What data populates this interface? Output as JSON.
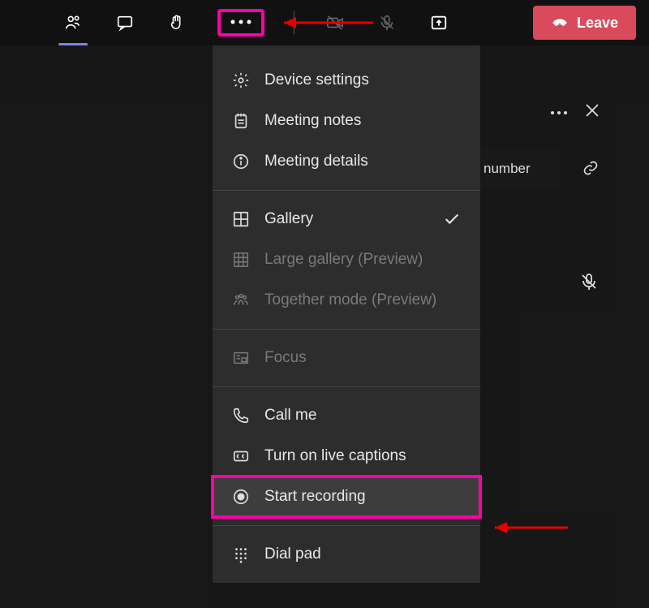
{
  "topbar": {
    "leave_label": "Leave"
  },
  "menu": {
    "device_settings": "Device settings",
    "meeting_notes": "Meeting notes",
    "meeting_details": "Meeting details",
    "gallery": "Gallery",
    "large_gallery": "Large gallery (Preview)",
    "together_mode": "Together mode (Preview)",
    "focus": "Focus",
    "call_me": "Call me",
    "live_captions": "Turn on live captions",
    "start_recording": "Start recording",
    "dial_pad": "Dial pad"
  },
  "partial": {
    "number": "number"
  }
}
